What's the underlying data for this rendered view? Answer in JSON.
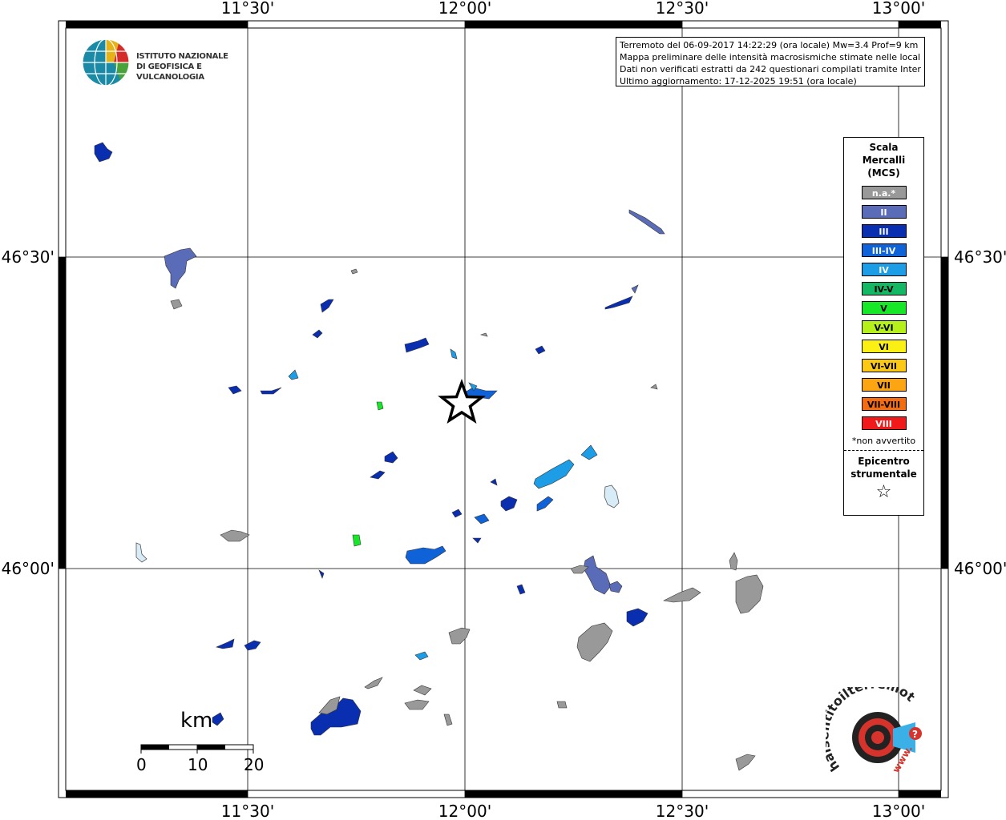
{
  "map": {
    "top_ticks": [
      "11°30'",
      "12°00'",
      "12°30'",
      "13°00'"
    ],
    "bottom_ticks": [
      "11°30'",
      "12°00'",
      "12°30'",
      "13°00'"
    ],
    "left_ticks": [
      "46°30'",
      "46°00'"
    ],
    "right_ticks": [
      "46°30'",
      "46°00'"
    ],
    "grid": true
  },
  "info": {
    "line1": "Terremoto del 06-09-2017 14:22:29 (ora locale) Mw=3.4 Prof=9 km",
    "line2": "Mappa preliminare delle intensità macrosismiche stimate nelle località",
    "line3": "Dati non verificati estratti da 242 questionari compilati tramite Internet.",
    "line4": "Ultimo aggiornamento: 17-12-2025 19:51 (ora locale)"
  },
  "logo": {
    "line1": "ISTITUTO NAZIONALE",
    "line2": "DI GEOFISICA E VULCANOLOGIA"
  },
  "legend": {
    "title1": "Scala",
    "title2": "Mercalli",
    "title3": "(MCS)",
    "items": [
      {
        "label": "n.a.*",
        "color": "#999999"
      },
      {
        "label": "II",
        "color": "#5a6cb8"
      },
      {
        "label": "III",
        "color": "#0a2eb0"
      },
      {
        "label": "III-IV",
        "color": "#0f62d8"
      },
      {
        "label": "IV",
        "color": "#1c9de6"
      },
      {
        "label": "IV-V",
        "color": "#14b864"
      },
      {
        "label": "V",
        "color": "#16e828"
      },
      {
        "label": "V-VI",
        "color": "#b6f01a"
      },
      {
        "label": "VI",
        "color": "#fbf013"
      },
      {
        "label": "VI-VII",
        "color": "#fbc913"
      },
      {
        "label": "VII",
        "color": "#fba513"
      },
      {
        "label": "VII-VIII",
        "color": "#f46b10"
      },
      {
        "label": "VIII",
        "color": "#f01a1a"
      }
    ],
    "note": "*non avvertito",
    "epi1": "Epicentro",
    "epi2": "strumentale",
    "star": "☆"
  },
  "scale": {
    "unit": "km",
    "labels": [
      "0",
      "10",
      "20"
    ]
  },
  "brand": {
    "text": "haisentitoilterremoto.it",
    "www": "www."
  }
}
